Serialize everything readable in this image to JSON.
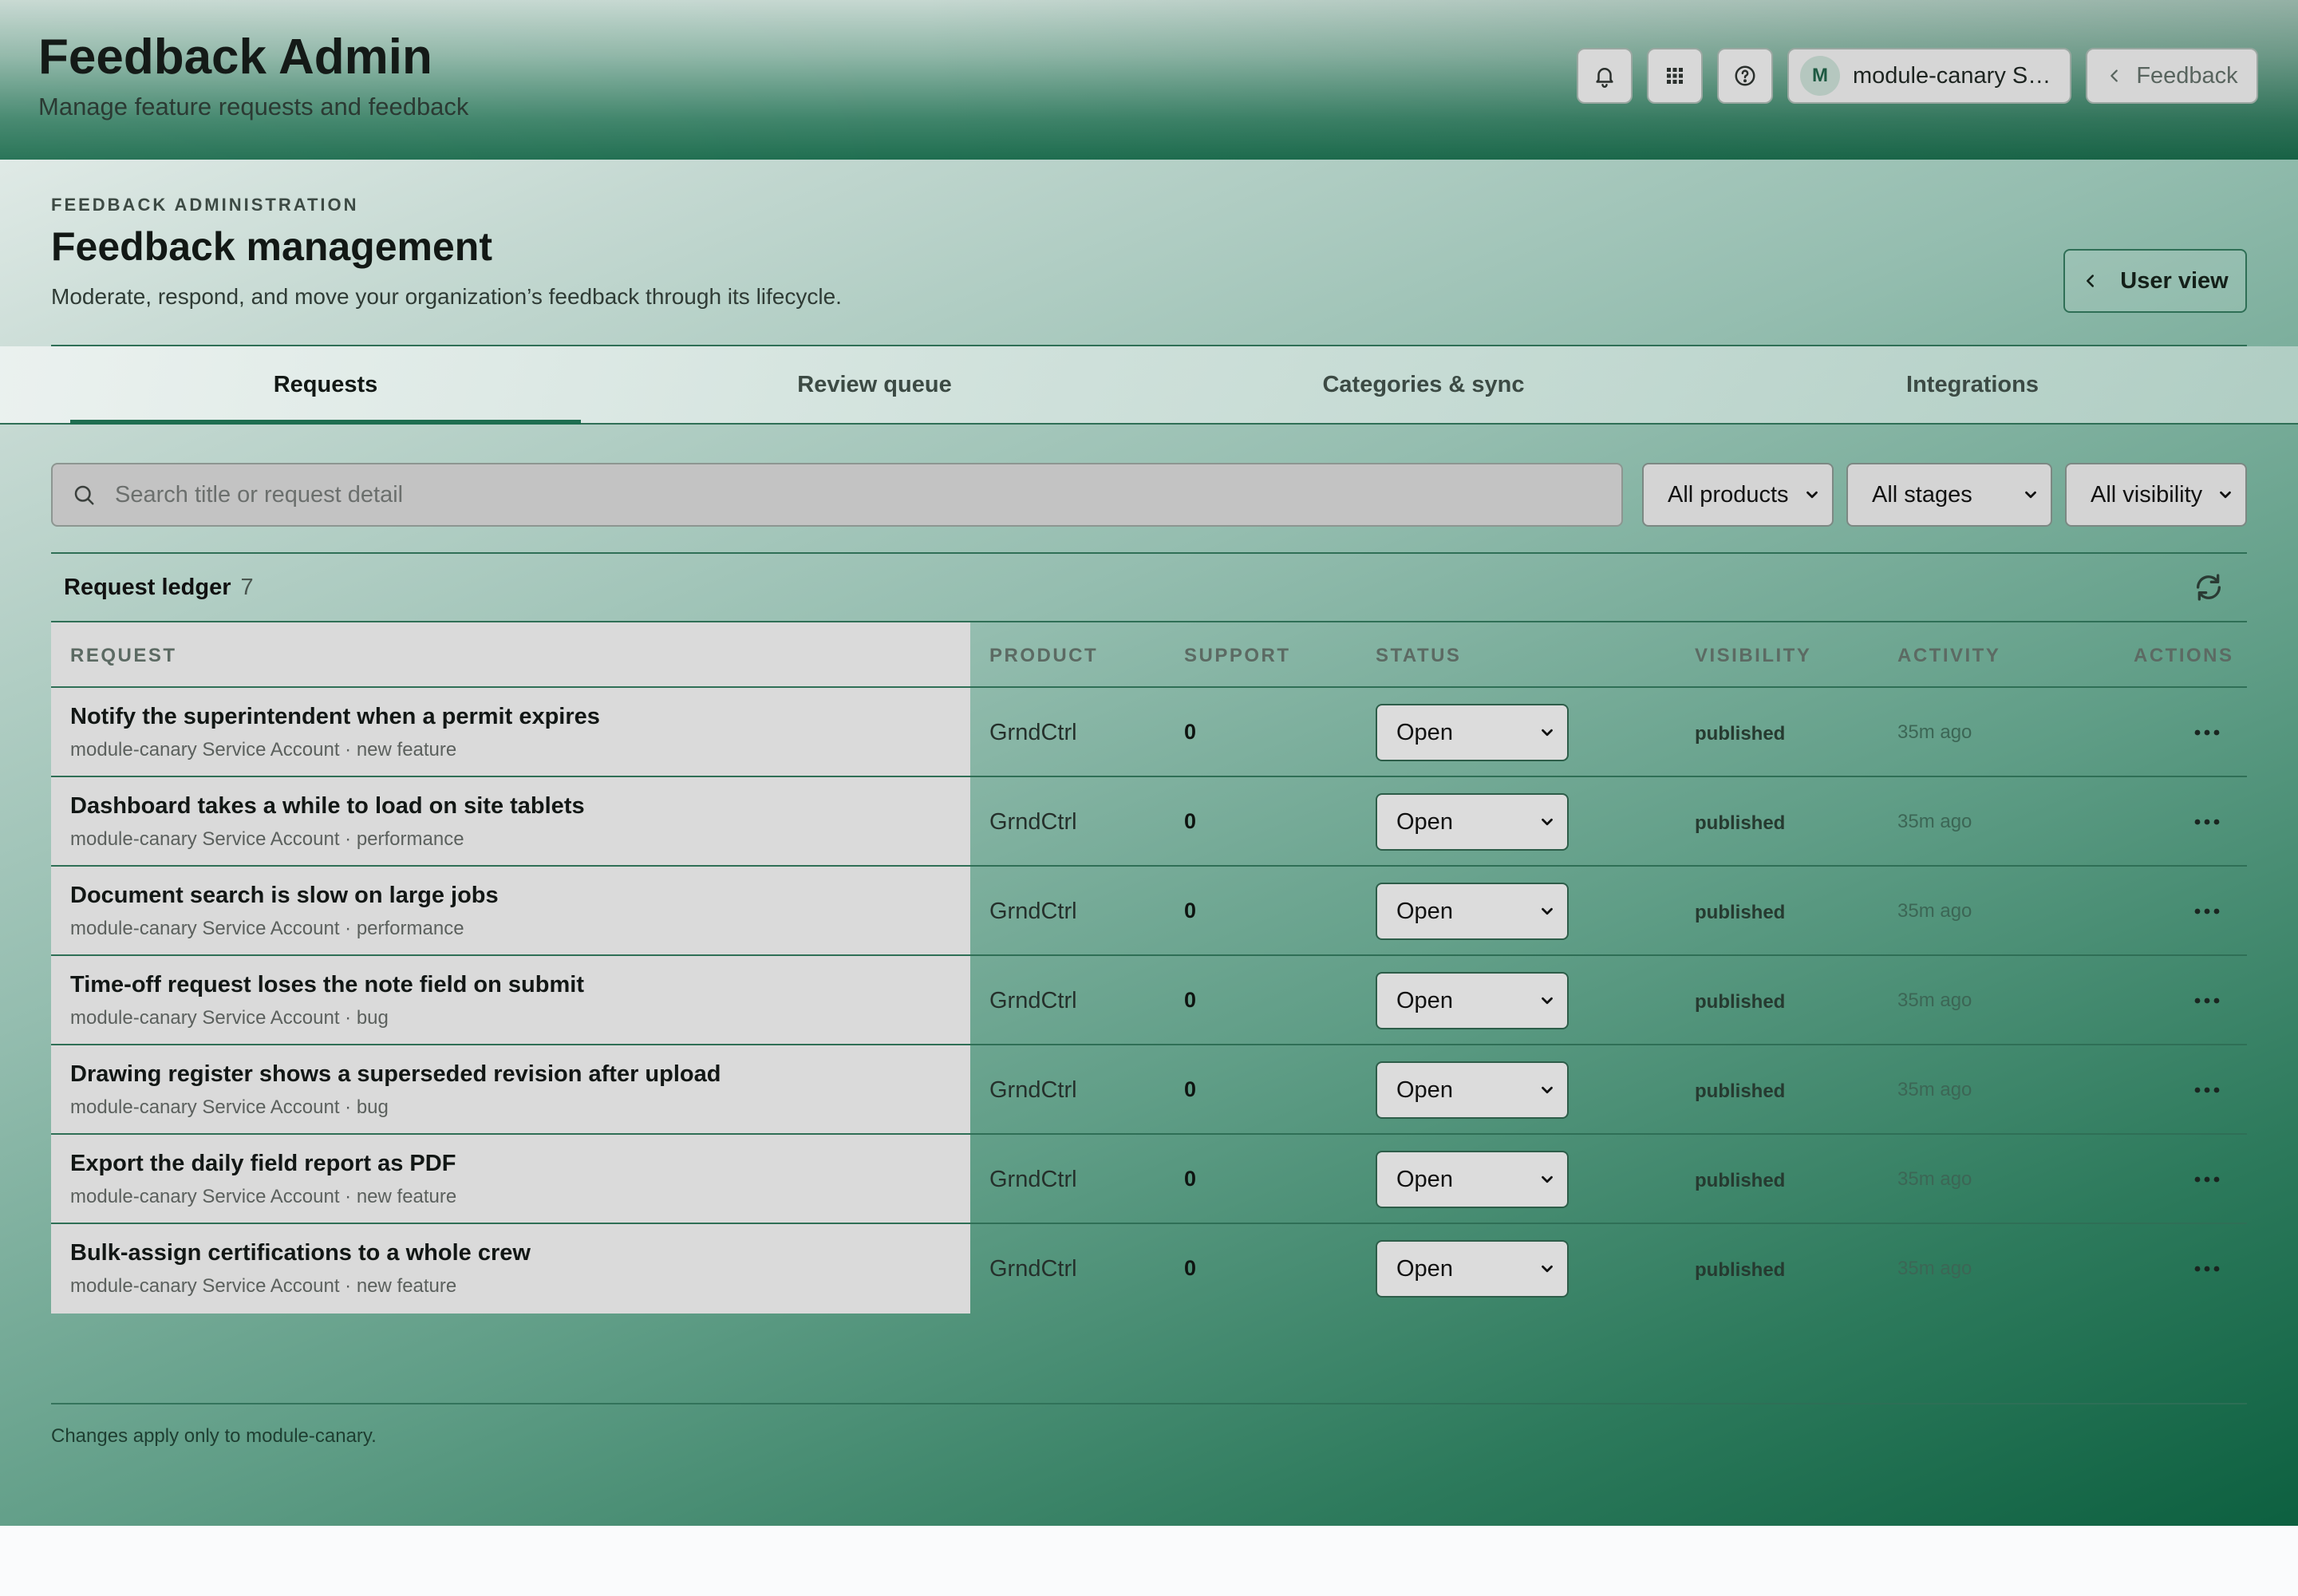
{
  "app": {
    "title": "Feedback Admin",
    "subtitle": "Manage feature requests and feedback"
  },
  "topbar": {
    "icons": [
      "bell-icon",
      "apps-grid-icon",
      "help-icon"
    ],
    "account": {
      "initial": "M",
      "name": "module-canary S…"
    },
    "feedback_label": "Feedback"
  },
  "header": {
    "eyebrow": "FEEDBACK ADMINISTRATION",
    "title": "Feedback management",
    "description": "Moderate, respond, and move your organization’s feedback through its lifecycle.",
    "user_view_label": "User view"
  },
  "tabs": [
    {
      "label": "Requests",
      "active": true
    },
    {
      "label": "Review queue",
      "active": false
    },
    {
      "label": "Categories & sync",
      "active": false
    },
    {
      "label": "Integrations",
      "active": false
    }
  ],
  "filters": {
    "search_placeholder": "Search title or request detail",
    "products": "All products",
    "stages": "All stages",
    "visibility": "All visibility"
  },
  "ledger": {
    "title": "Request ledger",
    "count": "7",
    "columns": {
      "request": "REQUEST",
      "product": "PRODUCT",
      "support": "SUPPORT",
      "status": "STATUS",
      "visibility": "VISIBILITY",
      "activity": "ACTIVITY",
      "actions": "ACTIONS"
    },
    "rows": [
      {
        "title": "Notify the superintendent when a permit expires",
        "meta": "module-canary Service Account · new feature",
        "product": "GrndCtrl",
        "support": "0",
        "status": "Open",
        "visibility": "published",
        "activity": "35m ago"
      },
      {
        "title": "Dashboard takes a while to load on site tablets",
        "meta": "module-canary Service Account · performance",
        "product": "GrndCtrl",
        "support": "0",
        "status": "Open",
        "visibility": "published",
        "activity": "35m ago"
      },
      {
        "title": "Document search is slow on large jobs",
        "meta": "module-canary Service Account · performance",
        "product": "GrndCtrl",
        "support": "0",
        "status": "Open",
        "visibility": "published",
        "activity": "35m ago"
      },
      {
        "title": "Time-off request loses the note field on submit",
        "meta": "module-canary Service Account · bug",
        "product": "GrndCtrl",
        "support": "0",
        "status": "Open",
        "visibility": "published",
        "activity": "35m ago"
      },
      {
        "title": "Drawing register shows a superseded revision after upload",
        "meta": "module-canary Service Account · bug",
        "product": "GrndCtrl",
        "support": "0",
        "status": "Open",
        "visibility": "published",
        "activity": "35m ago"
      },
      {
        "title": "Export the daily field report as PDF",
        "meta": "module-canary Service Account · new feature",
        "product": "GrndCtrl",
        "support": "0",
        "status": "Open",
        "visibility": "published",
        "activity": "35m ago"
      },
      {
        "title": "Bulk-assign certifications to a whole crew",
        "meta": "module-canary Service Account · new feature",
        "product": "GrndCtrl",
        "support": "0",
        "status": "Open",
        "visibility": "published",
        "activity": "35m ago"
      }
    ]
  },
  "footer": {
    "note": "Changes apply only to module-canary."
  },
  "colors": {
    "accent": "#1e6e50",
    "rule": "#2f6f56"
  }
}
